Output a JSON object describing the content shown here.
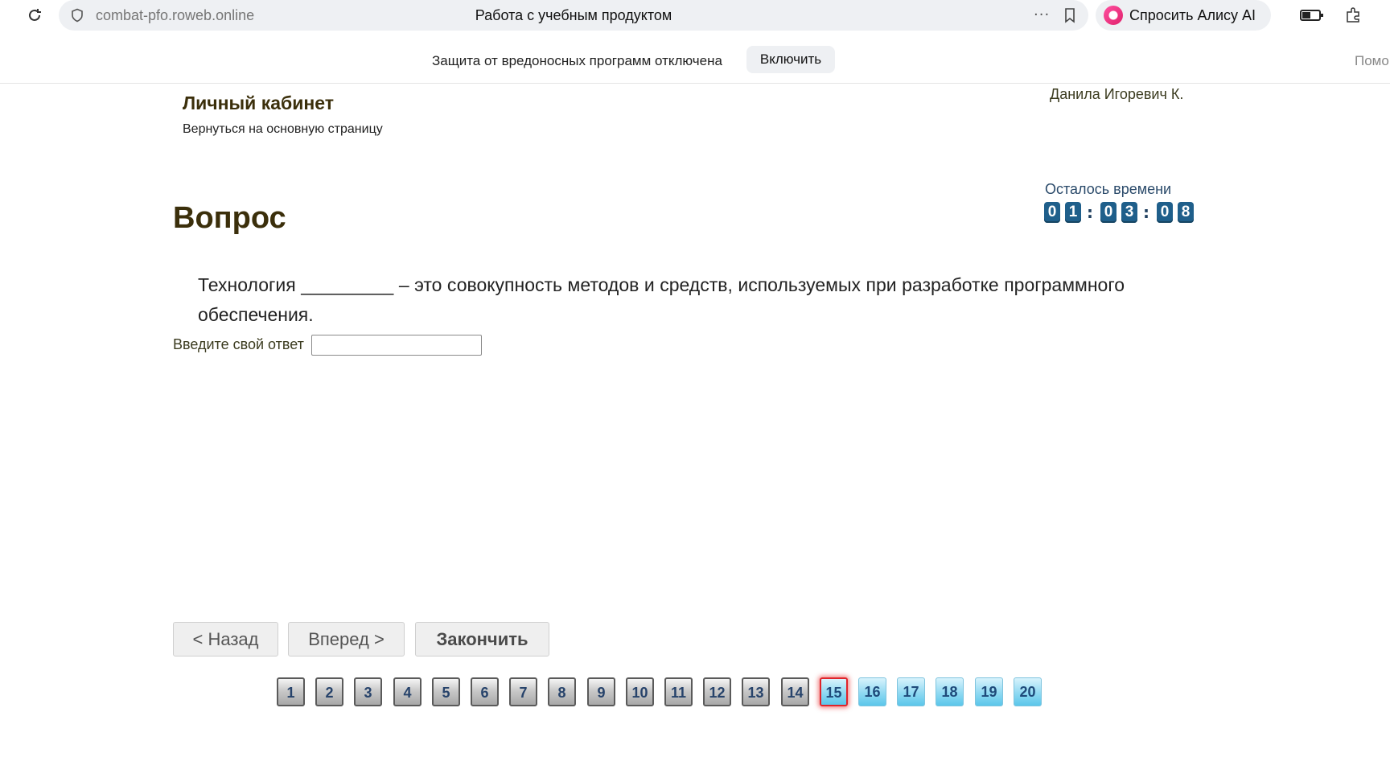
{
  "browser": {
    "url": "combat-pfo.roweb.online",
    "title": "Работа с учебным продуктом",
    "more_icon": "more-dots-icon",
    "alice_label": "Спросить Алису AI"
  },
  "notice": {
    "text": "Защита от вредоносных программ отключена",
    "enable_label": "Включить",
    "help_label": "Помощь"
  },
  "header": {
    "cabinet_title": "Личный кабинет",
    "back_link": "Вернуться на основную страницу",
    "user_name": "Данила Игоревич К."
  },
  "timer": {
    "label": "Осталось времени",
    "digits": [
      "0",
      "1",
      "0",
      "3",
      "0",
      "8"
    ],
    "separator": ":"
  },
  "question": {
    "heading": "Вопрос",
    "text": "Технология _________ – это совокупность методов и средств, используемых при разработке программного обеспечения.",
    "answer_label": "Введите свой ответ",
    "answer_value": ""
  },
  "nav": {
    "back": "< Назад",
    "forward": "Вперед >",
    "finish": "Закончить"
  },
  "pager": {
    "pages": [
      {
        "n": "1",
        "state": "done"
      },
      {
        "n": "2",
        "state": "done"
      },
      {
        "n": "3",
        "state": "done"
      },
      {
        "n": "4",
        "state": "done"
      },
      {
        "n": "5",
        "state": "done"
      },
      {
        "n": "6",
        "state": "done"
      },
      {
        "n": "7",
        "state": "done"
      },
      {
        "n": "8",
        "state": "done"
      },
      {
        "n": "9",
        "state": "done"
      },
      {
        "n": "10",
        "state": "done"
      },
      {
        "n": "11",
        "state": "done"
      },
      {
        "n": "12",
        "state": "done"
      },
      {
        "n": "13",
        "state": "done"
      },
      {
        "n": "14",
        "state": "done"
      },
      {
        "n": "15",
        "state": "current"
      },
      {
        "n": "16",
        "state": "todo"
      },
      {
        "n": "17",
        "state": "todo"
      },
      {
        "n": "18",
        "state": "todo"
      },
      {
        "n": "19",
        "state": "todo"
      },
      {
        "n": "20",
        "state": "todo"
      }
    ]
  }
}
